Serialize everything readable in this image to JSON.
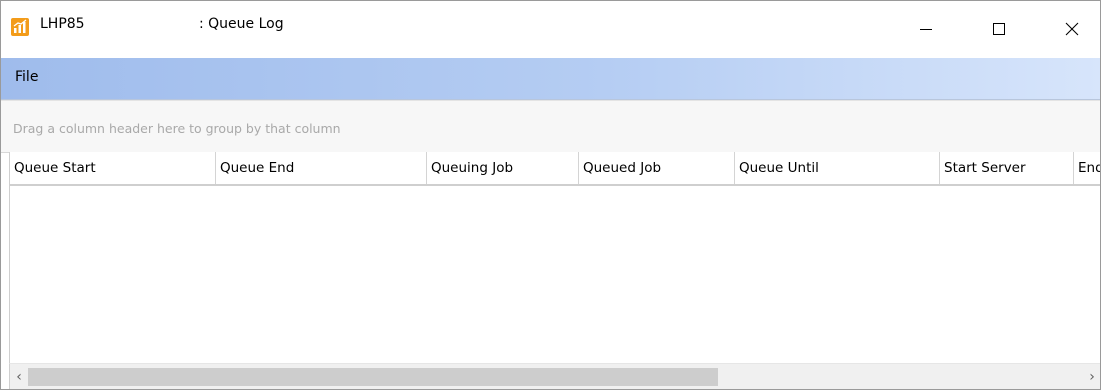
{
  "window": {
    "app_name": "LHP85",
    "title": ": Queue Log",
    "icon": "app-chart-icon",
    "controls": {
      "minimize_icon": "minimize-icon",
      "maximize_icon": "maximize-icon",
      "close_icon": "close-icon"
    }
  },
  "menu": {
    "items": [
      {
        "label": "File"
      }
    ]
  },
  "grid": {
    "group_panel_hint": "Drag a column header here to group by that column",
    "columns": [
      {
        "label": "Queue Start"
      },
      {
        "label": "Queue End"
      },
      {
        "label": "Queuing Job"
      },
      {
        "label": "Queued Job"
      },
      {
        "label": "Queue Until"
      },
      {
        "label": "Start Server"
      },
      {
        "label": "End"
      }
    ],
    "rows": []
  },
  "scrollbar": {
    "left_arrow": "‹",
    "right_arrow": "›"
  },
  "colors": {
    "menubar_accent": "#9fbcec",
    "app_icon": "#f39c1a"
  }
}
